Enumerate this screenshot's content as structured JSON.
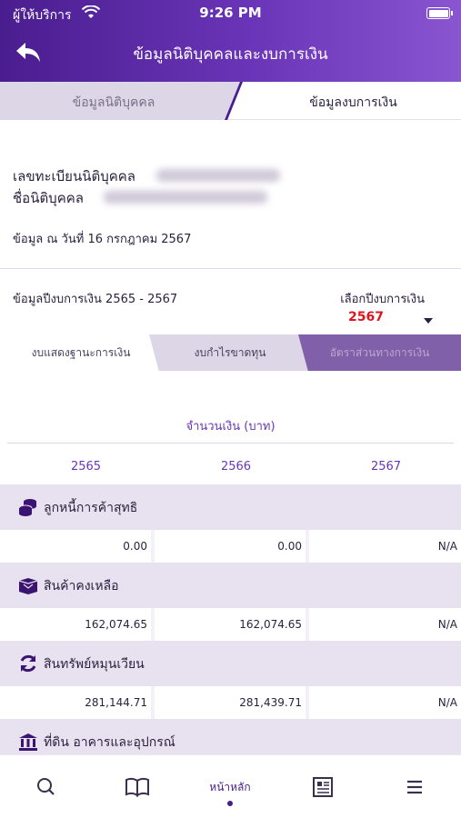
{
  "status": {
    "carrier": "ผู้ให้บริการ",
    "time": "9:26 PM"
  },
  "nav": {
    "title": "ข้อมูลนิติบุคคลและงบการเงิน"
  },
  "tabs": {
    "left": "ข้อมูลนิติบุคคล",
    "right": "ข้อมูลงบการเงิน"
  },
  "info": {
    "reg_label": "เลขทะเบียนนิติบุคคล",
    "name_label": "ชื่อนิติบุคคล",
    "as_of": "ข้อมูล ณ วันที่ 16 กรกฎาคม 2567"
  },
  "fiscal": {
    "title": "ข้อมูลปีงบการเงิน 2565 - 2567",
    "select_label": "เลือกปีงบการเงิน",
    "selected_year": "2567"
  },
  "subtabs": [
    {
      "label": "งบแสดงฐานะการเงิน"
    },
    {
      "label": "งบกำไรขาดทุน"
    },
    {
      "label": "อัตราส่วนทางการเงิน"
    }
  ],
  "table": {
    "amount_label": "จำนวนเงิน (บาท)",
    "years": [
      "2565",
      "2566",
      "2567"
    ],
    "rows": [
      {
        "label": "ลูกหนี้การค้าสุทธิ",
        "icon": "coins-icon",
        "values": [
          "0.00",
          "0.00",
          "N/A"
        ]
      },
      {
        "label": "สินค้าคงเหลือ",
        "icon": "box-icon",
        "values": [
          "162,074.65",
          "162,074.65",
          "N/A"
        ]
      },
      {
        "label": "สินทรัพย์หมุนเวียน",
        "icon": "refresh-icon",
        "values": [
          "281,144.71",
          "281,439.71",
          "N/A"
        ]
      },
      {
        "label": "ที่ดิน อาคารและอุปกรณ์",
        "icon": "bank-icon",
        "values": []
      }
    ]
  },
  "bottom_nav": {
    "home_label": "หน้าหลัก"
  },
  "colors": {
    "primary": "#4a1d8f",
    "accent_red": "#e0141e",
    "row_bg": "#e8e2f0"
  }
}
